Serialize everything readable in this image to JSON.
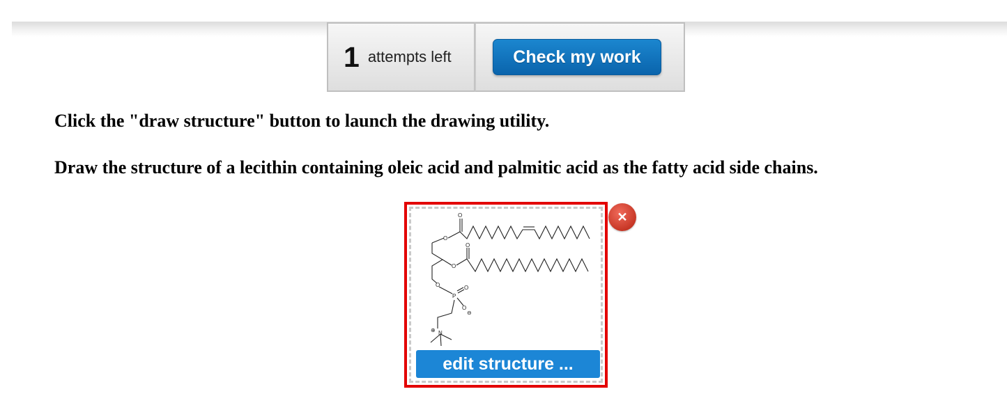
{
  "toolbar": {
    "attempts_count": "1",
    "attempts_label": "attempts left",
    "check_button_label": "Check my work"
  },
  "instructions": [
    "Click the \"draw structure\" button to launch the drawing utility.",
    "Draw the structure of a lecithin containing oleic acid and palmitic acid as the fatty acid side chains."
  ],
  "structure": {
    "atom_labels": {
      "o1": "O",
      "o2": "O",
      "o3": "O",
      "o4": "O",
      "o5": "O",
      "p": "P",
      "o6": "O",
      "o7": "O",
      "o8": "O",
      "n": "N",
      "minus": "⊖",
      "plus": "⊕"
    },
    "edit_button_label": "edit structure ...",
    "remove_icon": "✕"
  },
  "colors": {
    "button_blue": "#0a6ab4",
    "frame_red": "#e30000",
    "remove_red": "#d8402f"
  }
}
